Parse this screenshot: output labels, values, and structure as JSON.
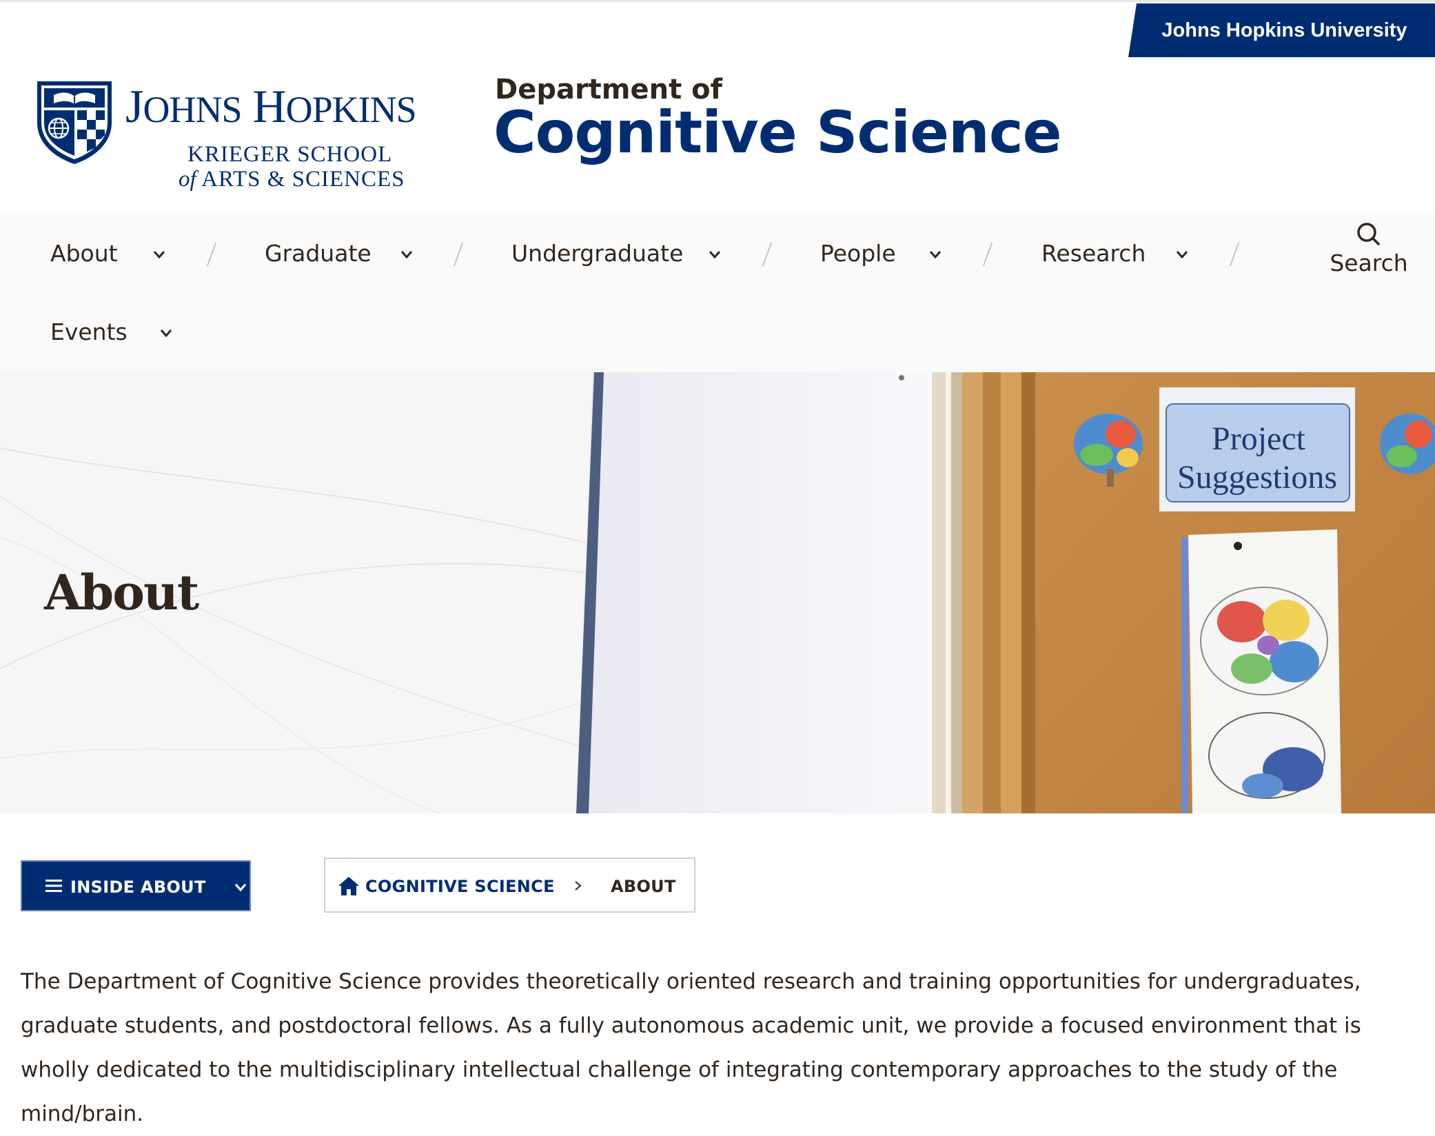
{
  "university_link": "Johns Hopkins University",
  "logo": {
    "line1_j": "J",
    "line1_ohns": "OHNS",
    "line1_h": "H",
    "line1_opkins": "OPKINS",
    "line2": "KRIEGER SCHOOL",
    "line3_of": "of",
    "line3": "ARTS & SCIENCES"
  },
  "department": {
    "prefix": "Department of",
    "name": "Cognitive Science"
  },
  "nav": {
    "items": [
      {
        "label": "About"
      },
      {
        "label": "Graduate"
      },
      {
        "label": "Undergraduate"
      },
      {
        "label": "People"
      },
      {
        "label": "Research"
      },
      {
        "label": "Events"
      }
    ],
    "search_label": "Search"
  },
  "hero": {
    "title": "About",
    "photo_sign_line1": "Project",
    "photo_sign_line2": "Suggestions"
  },
  "section_menu": {
    "label": "INSIDE ABOUT"
  },
  "breadcrumb": {
    "home": "COGNITIVE SCIENCE",
    "current": "ABOUT"
  },
  "body": {
    "paragraph": "The Department of Cognitive Science provides theoretically oriented research and training opportunities for undergraduates, graduate students, and postdoctoral fellows. As a fully autonomous academic unit, we provide a focused environment that is wholly dedicated to the multidisciplinary intellectual challenge of integrating contemporary approaches to the study of the mind/brain."
  },
  "colors": {
    "brand_blue": "#002d72",
    "text": "#31261d"
  }
}
